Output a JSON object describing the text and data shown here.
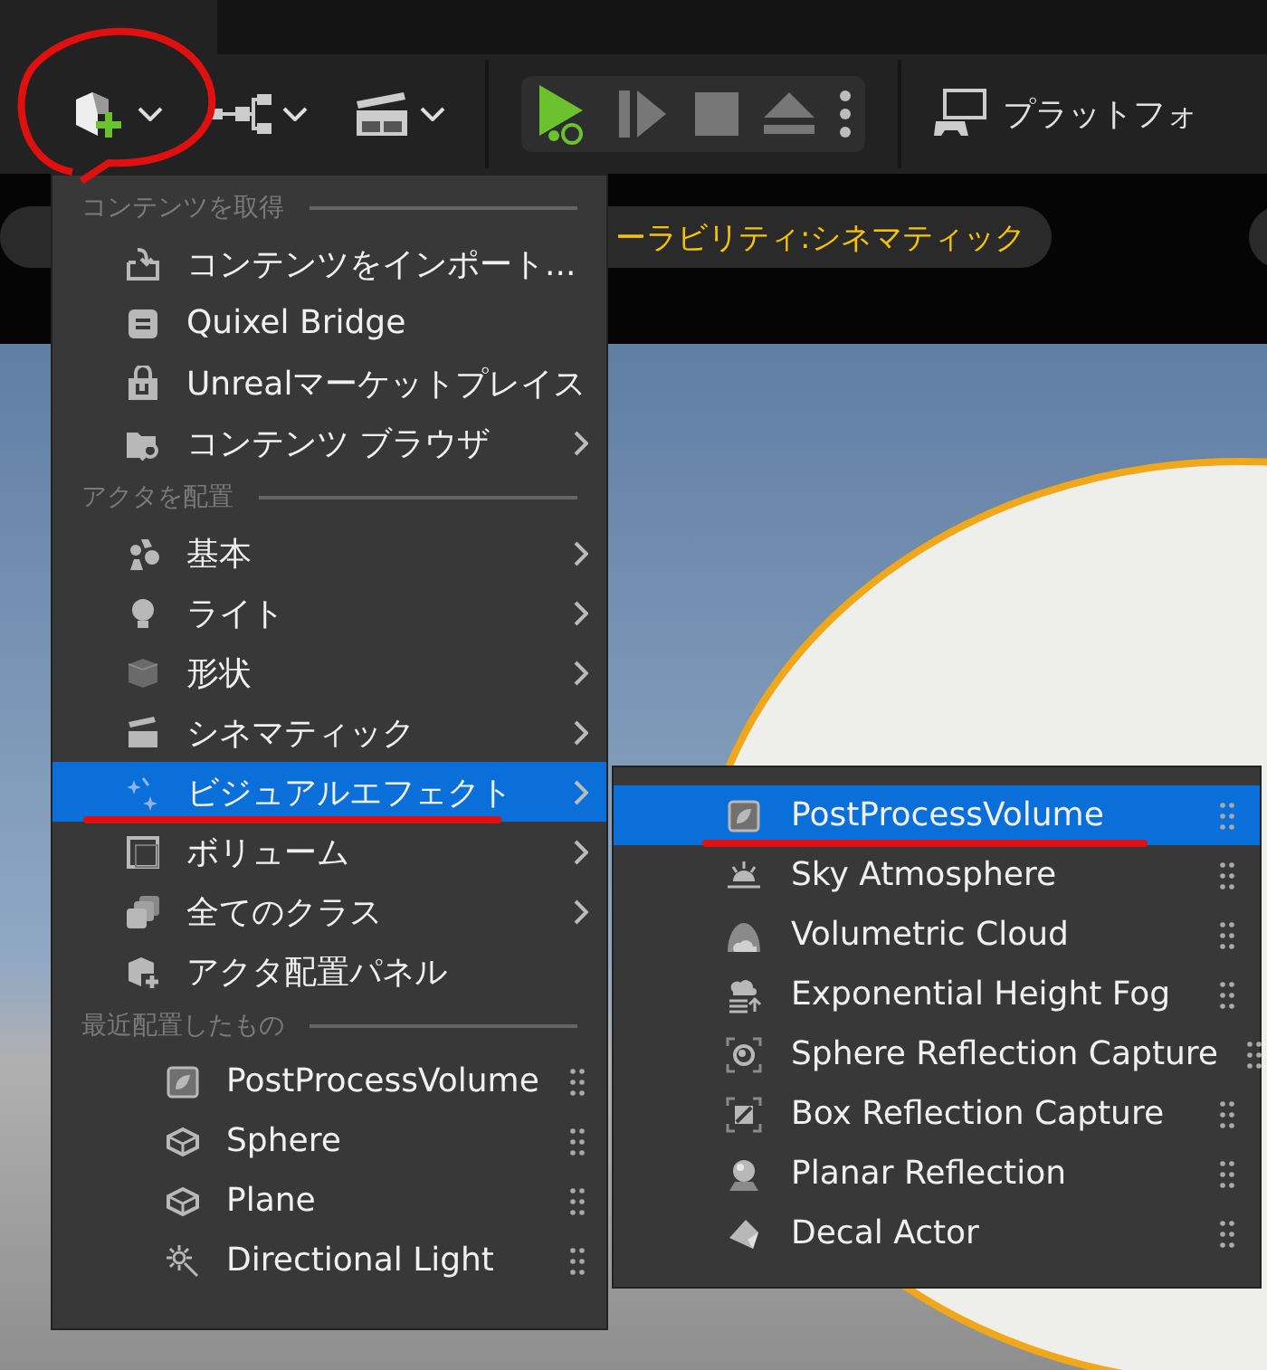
{
  "toolbar": {
    "platform_button": {
      "label": "プラットフォ"
    }
  },
  "viewport": {
    "mode_label": "ーラビリティ:シネマティック"
  },
  "add_menu": {
    "sections": [
      {
        "heading": "コンテンツを取得",
        "items": [
          {
            "label": "コンテンツをインポート...",
            "kind": "command",
            "has_submenu": false,
            "selected": false
          },
          {
            "label": "Quixel Bridge",
            "kind": "command",
            "has_submenu": false,
            "selected": false
          },
          {
            "label": "Unrealマーケットプレイス",
            "kind": "command",
            "has_submenu": false,
            "selected": false
          },
          {
            "label": "コンテンツ ブラウザ",
            "kind": "command",
            "has_submenu": true,
            "selected": false
          }
        ]
      },
      {
        "heading": "アクタを配置",
        "items": [
          {
            "label": "基本",
            "kind": "command",
            "has_submenu": true,
            "selected": false
          },
          {
            "label": "ライト",
            "kind": "command",
            "has_submenu": true,
            "selected": false
          },
          {
            "label": "形状",
            "kind": "command",
            "has_submenu": true,
            "selected": false
          },
          {
            "label": "シネマティック",
            "kind": "command",
            "has_submenu": true,
            "selected": false
          },
          {
            "label": "ビジュアルエフェクト",
            "kind": "command",
            "has_submenu": true,
            "selected": true
          },
          {
            "label": "ボリューム",
            "kind": "command",
            "has_submenu": true,
            "selected": false
          },
          {
            "label": "全てのクラス",
            "kind": "command",
            "has_submenu": true,
            "selected": false
          },
          {
            "label": "アクタ配置パネル",
            "kind": "command",
            "has_submenu": false,
            "selected": false
          }
        ]
      },
      {
        "heading": "最近配置したもの",
        "items": [
          {
            "label": "PostProcessVolume",
            "kind": "placeable",
            "has_submenu": false,
            "selected": false
          },
          {
            "label": "Sphere",
            "kind": "placeable",
            "has_submenu": false,
            "selected": false
          },
          {
            "label": "Plane",
            "kind": "placeable",
            "has_submenu": false,
            "selected": false
          },
          {
            "label": "Directional Light",
            "kind": "placeable",
            "has_submenu": false,
            "selected": false
          }
        ]
      }
    ]
  },
  "submenu": {
    "items": [
      {
        "label": "PostProcessVolume",
        "selected": true
      },
      {
        "label": "Sky Atmosphere",
        "selected": false
      },
      {
        "label": "Volumetric Cloud",
        "selected": false
      },
      {
        "label": "Exponential Height Fog",
        "selected": false
      },
      {
        "label": "Sphere Reflection Capture",
        "selected": false
      },
      {
        "label": "Box Reflection Capture",
        "selected": false
      },
      {
        "label": "Planar Reflection",
        "selected": false
      },
      {
        "label": "Decal Actor",
        "selected": false
      }
    ]
  }
}
